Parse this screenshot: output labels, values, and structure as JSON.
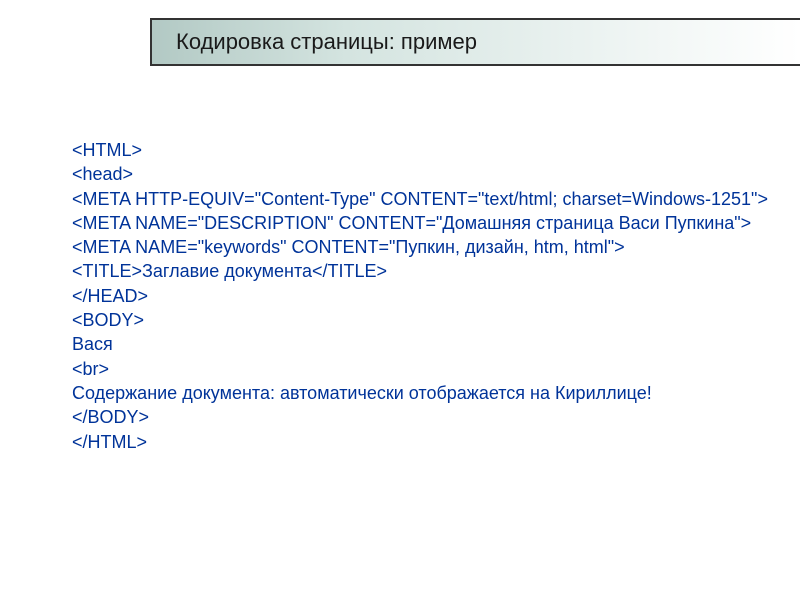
{
  "header": {
    "title": "Кодировка страницы: пример"
  },
  "code": {
    "lines": [
      "<HTML>",
      "<head>",
      "<META HTTP-EQUIV=\"Content-Type\" CONTENT=\"text/html; charset=Windows-1251\">",
      "<META NAME=\"DESCRIPTION\" CONTENT=\"Домашняя страница Васи Пупкина\">",
      "<META NAME=\"keywords\" CONTENT=\"Пупкин, дизайн, htm, html\">",
      "<TITLE>Заглавие документа</TITLE>",
      "</HEAD>",
      "<BODY>",
      "Вася",
      "<br>",
      "Содержание документа: автоматически отображается на Кириллице!",
      "</BODY>",
      "</HTML>"
    ]
  }
}
